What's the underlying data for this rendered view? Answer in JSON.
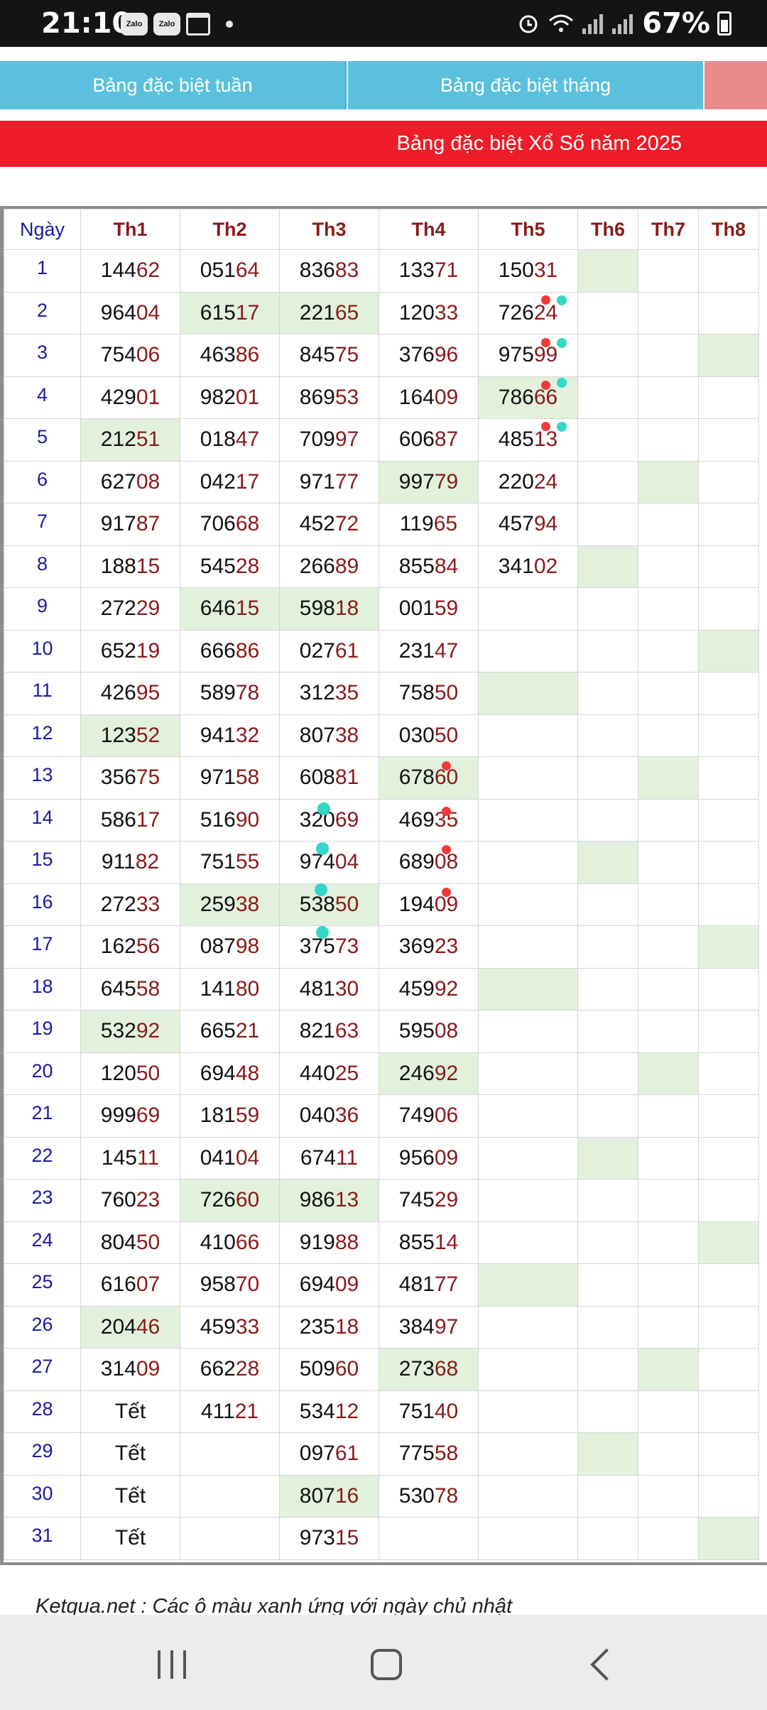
{
  "status_bar": {
    "time": "21:10",
    "app_icons": [
      "Zalo",
      "Zalo"
    ],
    "battery": "67%"
  },
  "tabs": [
    {
      "label": "Bảng đặc biệt tuần"
    },
    {
      "label": "Bảng đặc biệt tháng"
    }
  ],
  "banner": "Bảng đặc biệt Xổ Số năm 2025",
  "table": {
    "headers": [
      "Ngày",
      "Th1",
      "Th2",
      "Th3",
      "Th4",
      "Th5",
      "Th6",
      "Th7",
      "Th8"
    ],
    "rows": [
      {
        "day": "1",
        "cells": [
          {
            "v": "14462"
          },
          {
            "v": "05164"
          },
          {
            "v": "83683"
          },
          {
            "v": "13371"
          },
          {
            "v": "15031"
          },
          {
            "v": "",
            "sun": true
          },
          {
            "v": ""
          },
          {
            "v": ""
          }
        ]
      },
      {
        "day": "2",
        "cells": [
          {
            "v": "96404"
          },
          {
            "v": "61517",
            "sun": true
          },
          {
            "v": "22165",
            "sun": true
          },
          {
            "v": "12033"
          },
          {
            "v": "72624"
          },
          {
            "v": ""
          },
          {
            "v": ""
          },
          {
            "v": ""
          }
        ]
      },
      {
        "day": "3",
        "cells": [
          {
            "v": "75406"
          },
          {
            "v": "46386"
          },
          {
            "v": "84575"
          },
          {
            "v": "37696"
          },
          {
            "v": "97599"
          },
          {
            "v": ""
          },
          {
            "v": ""
          },
          {
            "v": "",
            "sun": true
          }
        ]
      },
      {
        "day": "4",
        "cells": [
          {
            "v": "42901"
          },
          {
            "v": "98201"
          },
          {
            "v": "86953"
          },
          {
            "v": "16409"
          },
          {
            "v": "78666",
            "sun": true
          },
          {
            "v": ""
          },
          {
            "v": ""
          },
          {
            "v": ""
          }
        ]
      },
      {
        "day": "5",
        "cells": [
          {
            "v": "21251",
            "sun": true
          },
          {
            "v": "01847"
          },
          {
            "v": "70997"
          },
          {
            "v": "60687"
          },
          {
            "v": "48513"
          },
          {
            "v": ""
          },
          {
            "v": ""
          },
          {
            "v": ""
          }
        ]
      },
      {
        "day": "6",
        "cells": [
          {
            "v": "62708"
          },
          {
            "v": "04217"
          },
          {
            "v": "97177"
          },
          {
            "v": "99779",
            "sun": true
          },
          {
            "v": "22024"
          },
          {
            "v": ""
          },
          {
            "v": "",
            "sun": true
          },
          {
            "v": ""
          }
        ]
      },
      {
        "day": "7",
        "cells": [
          {
            "v": "91787"
          },
          {
            "v": "70668"
          },
          {
            "v": "45272"
          },
          {
            "v": "11965"
          },
          {
            "v": "45794"
          },
          {
            "v": ""
          },
          {
            "v": ""
          },
          {
            "v": ""
          }
        ]
      },
      {
        "day": "8",
        "cells": [
          {
            "v": "18815"
          },
          {
            "v": "54528"
          },
          {
            "v": "26689"
          },
          {
            "v": "85584"
          },
          {
            "v": "34102"
          },
          {
            "v": "",
            "sun": true
          },
          {
            "v": ""
          },
          {
            "v": ""
          }
        ]
      },
      {
        "day": "9",
        "cells": [
          {
            "v": "27229"
          },
          {
            "v": "64615",
            "sun": true
          },
          {
            "v": "59818",
            "sun": true
          },
          {
            "v": "00159"
          },
          {
            "v": ""
          },
          {
            "v": ""
          },
          {
            "v": ""
          },
          {
            "v": ""
          }
        ]
      },
      {
        "day": "10",
        "cells": [
          {
            "v": "65219"
          },
          {
            "v": "66686"
          },
          {
            "v": "02761"
          },
          {
            "v": "23147"
          },
          {
            "v": ""
          },
          {
            "v": ""
          },
          {
            "v": ""
          },
          {
            "v": "",
            "sun": true
          }
        ]
      },
      {
        "day": "11",
        "cells": [
          {
            "v": "42695"
          },
          {
            "v": "58978"
          },
          {
            "v": "31235"
          },
          {
            "v": "75850"
          },
          {
            "v": "",
            "sun": true
          },
          {
            "v": ""
          },
          {
            "v": ""
          },
          {
            "v": ""
          }
        ]
      },
      {
        "day": "12",
        "cells": [
          {
            "v": "12352",
            "sun": true
          },
          {
            "v": "94132"
          },
          {
            "v": "80738"
          },
          {
            "v": "03050"
          },
          {
            "v": ""
          },
          {
            "v": ""
          },
          {
            "v": ""
          },
          {
            "v": ""
          }
        ]
      },
      {
        "day": "13",
        "cells": [
          {
            "v": "35675"
          },
          {
            "v": "97158"
          },
          {
            "v": "60881"
          },
          {
            "v": "67860",
            "sun": true
          },
          {
            "v": ""
          },
          {
            "v": ""
          },
          {
            "v": "",
            "sun": true
          },
          {
            "v": ""
          }
        ]
      },
      {
        "day": "14",
        "cells": [
          {
            "v": "58617"
          },
          {
            "v": "51690"
          },
          {
            "v": "32069"
          },
          {
            "v": "46935"
          },
          {
            "v": ""
          },
          {
            "v": ""
          },
          {
            "v": ""
          },
          {
            "v": ""
          }
        ]
      },
      {
        "day": "15",
        "cells": [
          {
            "v": "91182"
          },
          {
            "v": "75155"
          },
          {
            "v": "97404"
          },
          {
            "v": "68908"
          },
          {
            "v": ""
          },
          {
            "v": "",
            "sun": true
          },
          {
            "v": ""
          },
          {
            "v": ""
          }
        ]
      },
      {
        "day": "16",
        "cells": [
          {
            "v": "27233"
          },
          {
            "v": "25938",
            "sun": true
          },
          {
            "v": "53850",
            "sun": true
          },
          {
            "v": "19409"
          },
          {
            "v": ""
          },
          {
            "v": ""
          },
          {
            "v": ""
          },
          {
            "v": ""
          }
        ]
      },
      {
        "day": "17",
        "cells": [
          {
            "v": "16256"
          },
          {
            "v": "08798"
          },
          {
            "v": "37573"
          },
          {
            "v": "36923"
          },
          {
            "v": ""
          },
          {
            "v": ""
          },
          {
            "v": ""
          },
          {
            "v": "",
            "sun": true
          }
        ]
      },
      {
        "day": "18",
        "cells": [
          {
            "v": "64558"
          },
          {
            "v": "14180"
          },
          {
            "v": "48130"
          },
          {
            "v": "45992"
          },
          {
            "v": "",
            "sun": true
          },
          {
            "v": ""
          },
          {
            "v": ""
          },
          {
            "v": ""
          }
        ]
      },
      {
        "day": "19",
        "cells": [
          {
            "v": "53292",
            "sun": true
          },
          {
            "v": "66521"
          },
          {
            "v": "82163"
          },
          {
            "v": "59508"
          },
          {
            "v": ""
          },
          {
            "v": ""
          },
          {
            "v": ""
          },
          {
            "v": ""
          }
        ]
      },
      {
        "day": "20",
        "cells": [
          {
            "v": "12050"
          },
          {
            "v": "69448"
          },
          {
            "v": "44025"
          },
          {
            "v": "24692",
            "sun": true
          },
          {
            "v": ""
          },
          {
            "v": ""
          },
          {
            "v": "",
            "sun": true
          },
          {
            "v": ""
          }
        ]
      },
      {
        "day": "21",
        "cells": [
          {
            "v": "99969"
          },
          {
            "v": "18159"
          },
          {
            "v": "04036"
          },
          {
            "v": "74906"
          },
          {
            "v": ""
          },
          {
            "v": ""
          },
          {
            "v": ""
          },
          {
            "v": ""
          }
        ]
      },
      {
        "day": "22",
        "cells": [
          {
            "v": "14511"
          },
          {
            "v": "04104"
          },
          {
            "v": "67411"
          },
          {
            "v": "95609"
          },
          {
            "v": ""
          },
          {
            "v": "",
            "sun": true
          },
          {
            "v": ""
          },
          {
            "v": ""
          }
        ]
      },
      {
        "day": "23",
        "cells": [
          {
            "v": "76023"
          },
          {
            "v": "72660",
            "sun": true
          },
          {
            "v": "98613",
            "sun": true
          },
          {
            "v": "74529"
          },
          {
            "v": ""
          },
          {
            "v": ""
          },
          {
            "v": ""
          },
          {
            "v": ""
          }
        ]
      },
      {
        "day": "24",
        "cells": [
          {
            "v": "80450"
          },
          {
            "v": "41066"
          },
          {
            "v": "91988"
          },
          {
            "v": "85514"
          },
          {
            "v": ""
          },
          {
            "v": ""
          },
          {
            "v": ""
          },
          {
            "v": "",
            "sun": true
          }
        ]
      },
      {
        "day": "25",
        "cells": [
          {
            "v": "61607"
          },
          {
            "v": "95870"
          },
          {
            "v": "69409"
          },
          {
            "v": "48177"
          },
          {
            "v": "",
            "sun": true
          },
          {
            "v": ""
          },
          {
            "v": ""
          },
          {
            "v": ""
          }
        ]
      },
      {
        "day": "26",
        "cells": [
          {
            "v": "20446",
            "sun": true
          },
          {
            "v": "45933"
          },
          {
            "v": "23518"
          },
          {
            "v": "38497"
          },
          {
            "v": ""
          },
          {
            "v": ""
          },
          {
            "v": ""
          },
          {
            "v": ""
          }
        ]
      },
      {
        "day": "27",
        "cells": [
          {
            "v": "31409"
          },
          {
            "v": "66228"
          },
          {
            "v": "50960"
          },
          {
            "v": "27368",
            "sun": true
          },
          {
            "v": ""
          },
          {
            "v": ""
          },
          {
            "v": "",
            "sun": true
          },
          {
            "v": ""
          }
        ]
      },
      {
        "day": "28",
        "cells": [
          {
            "v": "Tết"
          },
          {
            "v": "41121"
          },
          {
            "v": "53412"
          },
          {
            "v": "75140"
          },
          {
            "v": ""
          },
          {
            "v": ""
          },
          {
            "v": ""
          },
          {
            "v": ""
          }
        ]
      },
      {
        "day": "29",
        "cells": [
          {
            "v": "Tết"
          },
          {
            "v": ""
          },
          {
            "v": "09761"
          },
          {
            "v": "77558"
          },
          {
            "v": ""
          },
          {
            "v": "",
            "sun": true
          },
          {
            "v": ""
          },
          {
            "v": ""
          }
        ]
      },
      {
        "day": "30",
        "cells": [
          {
            "v": "Tết"
          },
          {
            "v": ""
          },
          {
            "v": "80716",
            "sun": true
          },
          {
            "v": "53078"
          },
          {
            "v": ""
          },
          {
            "v": ""
          },
          {
            "v": ""
          },
          {
            "v": ""
          }
        ]
      },
      {
        "day": "31",
        "cells": [
          {
            "v": "Tết"
          },
          {
            "v": ""
          },
          {
            "v": "97315"
          },
          {
            "v": ""
          },
          {
            "v": ""
          },
          {
            "v": ""
          },
          {
            "v": ""
          },
          {
            "v": "",
            "sun": true
          }
        ]
      }
    ]
  },
  "footnote": "Ketqua.net : Các ô màu xanh ứng với ngày chủ nhật",
  "colors": {
    "tab_bg": "#5bc0de",
    "banner_bg": "#ef1c2a",
    "sunday_cell": "#e2f1dc",
    "day_text": "#1a1aa6",
    "tail_digits": "#8b1a1a",
    "dot_red": "#f03a3a",
    "dot_cyan": "#35d6c8"
  }
}
